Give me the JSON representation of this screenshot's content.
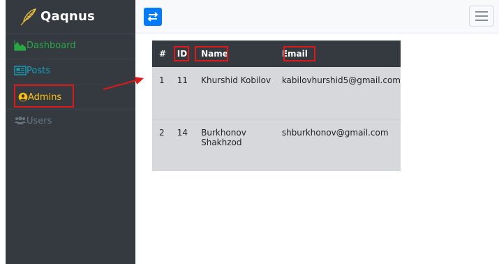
{
  "brand": {
    "name": "Qaqnus"
  },
  "sidebar": {
    "items": [
      {
        "label": "Dashboard",
        "icon": "area-chart-icon"
      },
      {
        "label": "Posts",
        "icon": "newspaper-icon"
      },
      {
        "label": "Admins",
        "icon": "user-circle-icon"
      },
      {
        "label": "Users",
        "icon": "users-icon"
      }
    ]
  },
  "topbar": {
    "toggle_icon": "exchange-icon",
    "menu_icon": "hamburger-icon"
  },
  "table": {
    "headers": [
      "#",
      "ID",
      "Name",
      "Email"
    ],
    "rows": [
      [
        "1",
        "11",
        "Khurshid Kobilov",
        "kabilovhurshid5@gmail.com"
      ],
      [
        "2",
        "14",
        "Burkhonov Shakhzod",
        "shburkhonov@gmail.com"
      ]
    ]
  },
  "colors": {
    "sidebar_bg": "#343a40",
    "dashboard": "#28a745",
    "posts": "#17a2b8",
    "admins": "#ffc107",
    "users": "#6c757d",
    "primary": "#007bff",
    "highlight": "#e01818"
  }
}
